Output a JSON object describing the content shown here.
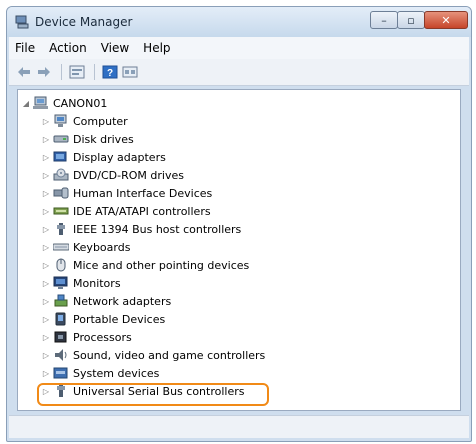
{
  "window": {
    "title": "Device Manager",
    "controls": {
      "minimize": "–",
      "maximize": "▫",
      "close": "✕"
    }
  },
  "menu": [
    "File",
    "Action",
    "View",
    "Help"
  ],
  "toolbar_icons": [
    "back-arrow-icon",
    "forward-arrow-icon",
    "properties-icon",
    "help-icon",
    "view-icon"
  ],
  "tree": {
    "root": {
      "label": "CANON01",
      "expander": "◢"
    },
    "collapsed_glyph": "▷",
    "items": [
      {
        "label": "Computer",
        "icon": "computer-icon"
      },
      {
        "label": "Disk drives",
        "icon": "disk-drive-icon"
      },
      {
        "label": "Display adapters",
        "icon": "display-adapter-icon"
      },
      {
        "label": "DVD/CD-ROM drives",
        "icon": "dvd-drive-icon"
      },
      {
        "label": "Human Interface Devices",
        "icon": "hid-icon"
      },
      {
        "label": "IDE ATA/ATAPI controllers",
        "icon": "ide-controller-icon"
      },
      {
        "label": "IEEE 1394 Bus host controllers",
        "icon": "ieee1394-icon"
      },
      {
        "label": "Keyboards",
        "icon": "keyboard-icon"
      },
      {
        "label": "Mice and other pointing devices",
        "icon": "mouse-icon"
      },
      {
        "label": "Monitors",
        "icon": "monitor-icon"
      },
      {
        "label": "Network adapters",
        "icon": "network-adapter-icon"
      },
      {
        "label": "Portable Devices",
        "icon": "portable-device-icon"
      },
      {
        "label": "Processors",
        "icon": "processor-icon"
      },
      {
        "label": "Sound, video and game controllers",
        "icon": "sound-icon"
      },
      {
        "label": "System devices",
        "icon": "system-devices-icon"
      },
      {
        "label": "Universal Serial Bus controllers",
        "icon": "usb-icon",
        "highlighted": true
      }
    ]
  },
  "colors": {
    "highlight_outline": "#f18a17",
    "window_frame": "#cfdeee"
  }
}
